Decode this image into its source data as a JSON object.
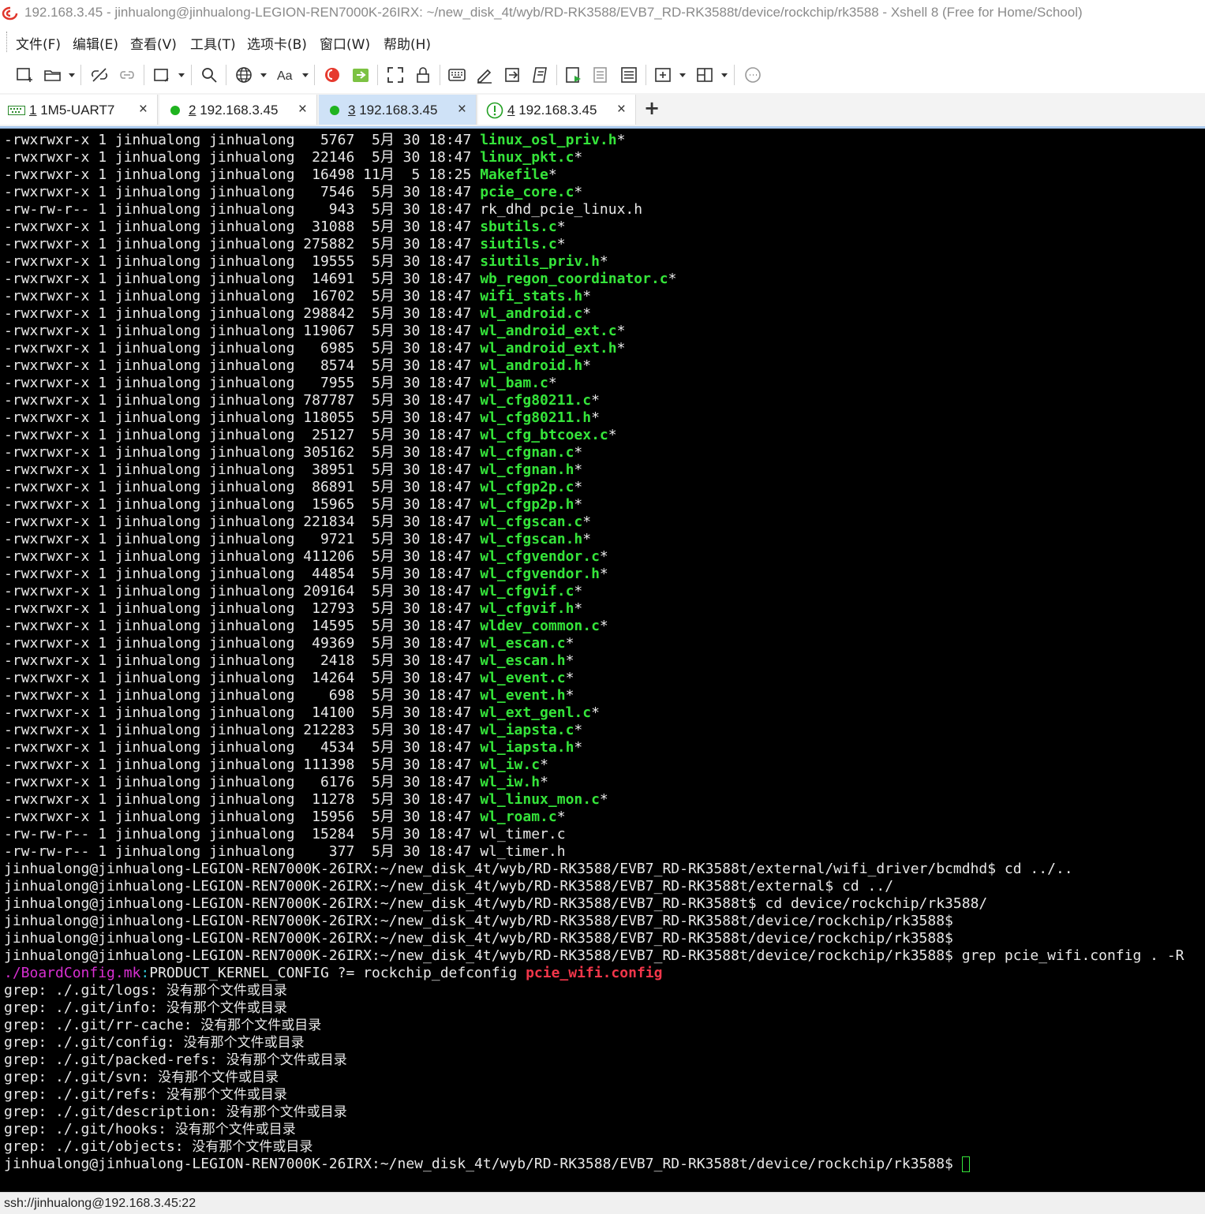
{
  "window": {
    "title": "192.168.3.45 - jinhualong@jinhualong-LEGION-REN7000K-26IRX: ~/new_disk_4t/wyb/RD-RK3588/EVB7_RD-RK3588t/device/rockchip/rk3588 - Xshell 8 (Free for Home/School)"
  },
  "menu": [
    {
      "label": "文件(F)"
    },
    {
      "label": "编辑(E)"
    },
    {
      "label": "查看(V)"
    },
    {
      "label": "工具(T)"
    },
    {
      "label": "选项卡(B)"
    },
    {
      "label": "窗口(W)"
    },
    {
      "label": "帮助(H)"
    }
  ],
  "tabs": [
    {
      "num": "1",
      "name": "1M5-UART7",
      "status": "serial",
      "active": false
    },
    {
      "num": "2",
      "name": "192.168.3.45",
      "status": "connected",
      "active": false
    },
    {
      "num": "3",
      "name": "192.168.3.45",
      "status": "connected",
      "active": true
    },
    {
      "num": "4",
      "name": "192.168.3.45",
      "status": "warning",
      "active": false
    }
  ],
  "terminal": {
    "listing": [
      {
        "meta": "-rwxrwxr-x 1 jinhualong jinhualong   5767  5月 30 18:47 ",
        "name": "linux_osl_priv.h",
        "exec": true
      },
      {
        "meta": "-rwxrwxr-x 1 jinhualong jinhualong  22146  5月 30 18:47 ",
        "name": "linux_pkt.c",
        "exec": true
      },
      {
        "meta": "-rwxrwxr-x 1 jinhualong jinhualong  16498 11月  5 18:25 ",
        "name": "Makefile",
        "exec": true
      },
      {
        "meta": "-rwxrwxr-x 1 jinhualong jinhualong   7546  5月 30 18:47 ",
        "name": "pcie_core.c",
        "exec": true
      },
      {
        "meta": "-rw-rw-r-- 1 jinhualong jinhualong    943  5月 30 18:47 ",
        "name": "rk_dhd_pcie_linux.h",
        "exec": false
      },
      {
        "meta": "-rwxrwxr-x 1 jinhualong jinhualong  31088  5月 30 18:47 ",
        "name": "sbutils.c",
        "exec": true
      },
      {
        "meta": "-rwxrwxr-x 1 jinhualong jinhualong 275882  5月 30 18:47 ",
        "name": "siutils.c",
        "exec": true
      },
      {
        "meta": "-rwxrwxr-x 1 jinhualong jinhualong  19555  5月 30 18:47 ",
        "name": "siutils_priv.h",
        "exec": true
      },
      {
        "meta": "-rwxrwxr-x 1 jinhualong jinhualong  14691  5月 30 18:47 ",
        "name": "wb_regon_coordinator.c",
        "exec": true
      },
      {
        "meta": "-rwxrwxr-x 1 jinhualong jinhualong  16702  5月 30 18:47 ",
        "name": "wifi_stats.h",
        "exec": true
      },
      {
        "meta": "-rwxrwxr-x 1 jinhualong jinhualong 298842  5月 30 18:47 ",
        "name": "wl_android.c",
        "exec": true
      },
      {
        "meta": "-rwxrwxr-x 1 jinhualong jinhualong 119067  5月 30 18:47 ",
        "name": "wl_android_ext.c",
        "exec": true
      },
      {
        "meta": "-rwxrwxr-x 1 jinhualong jinhualong   6985  5月 30 18:47 ",
        "name": "wl_android_ext.h",
        "exec": true
      },
      {
        "meta": "-rwxrwxr-x 1 jinhualong jinhualong   8574  5月 30 18:47 ",
        "name": "wl_android.h",
        "exec": true
      },
      {
        "meta": "-rwxrwxr-x 1 jinhualong jinhualong   7955  5月 30 18:47 ",
        "name": "wl_bam.c",
        "exec": true
      },
      {
        "meta": "-rwxrwxr-x 1 jinhualong jinhualong 787787  5月 30 18:47 ",
        "name": "wl_cfg80211.c",
        "exec": true
      },
      {
        "meta": "-rwxrwxr-x 1 jinhualong jinhualong 118055  5月 30 18:47 ",
        "name": "wl_cfg80211.h",
        "exec": true
      },
      {
        "meta": "-rwxrwxr-x 1 jinhualong jinhualong  25127  5月 30 18:47 ",
        "name": "wl_cfg_btcoex.c",
        "exec": true
      },
      {
        "meta": "-rwxrwxr-x 1 jinhualong jinhualong 305162  5月 30 18:47 ",
        "name": "wl_cfgnan.c",
        "exec": true
      },
      {
        "meta": "-rwxrwxr-x 1 jinhualong jinhualong  38951  5月 30 18:47 ",
        "name": "wl_cfgnan.h",
        "exec": true
      },
      {
        "meta": "-rwxrwxr-x 1 jinhualong jinhualong  86891  5月 30 18:47 ",
        "name": "wl_cfgp2p.c",
        "exec": true
      },
      {
        "meta": "-rwxrwxr-x 1 jinhualong jinhualong  15965  5月 30 18:47 ",
        "name": "wl_cfgp2p.h",
        "exec": true
      },
      {
        "meta": "-rwxrwxr-x 1 jinhualong jinhualong 221834  5月 30 18:47 ",
        "name": "wl_cfgscan.c",
        "exec": true
      },
      {
        "meta": "-rwxrwxr-x 1 jinhualong jinhualong   9721  5月 30 18:47 ",
        "name": "wl_cfgscan.h",
        "exec": true
      },
      {
        "meta": "-rwxrwxr-x 1 jinhualong jinhualong 411206  5月 30 18:47 ",
        "name": "wl_cfgvendor.c",
        "exec": true
      },
      {
        "meta": "-rwxrwxr-x 1 jinhualong jinhualong  44854  5月 30 18:47 ",
        "name": "wl_cfgvendor.h",
        "exec": true
      },
      {
        "meta": "-rwxrwxr-x 1 jinhualong jinhualong 209164  5月 30 18:47 ",
        "name": "wl_cfgvif.c",
        "exec": true
      },
      {
        "meta": "-rwxrwxr-x 1 jinhualong jinhualong  12793  5月 30 18:47 ",
        "name": "wl_cfgvif.h",
        "exec": true
      },
      {
        "meta": "-rwxrwxr-x 1 jinhualong jinhualong  14595  5月 30 18:47 ",
        "name": "wldev_common.c",
        "exec": true
      },
      {
        "meta": "-rwxrwxr-x 1 jinhualong jinhualong  49369  5月 30 18:47 ",
        "name": "wl_escan.c",
        "exec": true
      },
      {
        "meta": "-rwxrwxr-x 1 jinhualong jinhualong   2418  5月 30 18:47 ",
        "name": "wl_escan.h",
        "exec": true
      },
      {
        "meta": "-rwxrwxr-x 1 jinhualong jinhualong  14264  5月 30 18:47 ",
        "name": "wl_event.c",
        "exec": true
      },
      {
        "meta": "-rwxrwxr-x 1 jinhualong jinhualong    698  5月 30 18:47 ",
        "name": "wl_event.h",
        "exec": true
      },
      {
        "meta": "-rwxrwxr-x 1 jinhualong jinhualong  14100  5月 30 18:47 ",
        "name": "wl_ext_genl.c",
        "exec": true
      },
      {
        "meta": "-rwxrwxr-x 1 jinhualong jinhualong 212283  5月 30 18:47 ",
        "name": "wl_iapsta.c",
        "exec": true
      },
      {
        "meta": "-rwxrwxr-x 1 jinhualong jinhualong   4534  5月 30 18:47 ",
        "name": "wl_iapsta.h",
        "exec": true
      },
      {
        "meta": "-rwxrwxr-x 1 jinhualong jinhualong 111398  5月 30 18:47 ",
        "name": "wl_iw.c",
        "exec": true
      },
      {
        "meta": "-rwxrwxr-x 1 jinhualong jinhualong   6176  5月 30 18:47 ",
        "name": "wl_iw.h",
        "exec": true
      },
      {
        "meta": "-rwxrwxr-x 1 jinhualong jinhualong  11278  5月 30 18:47 ",
        "name": "wl_linux_mon.c",
        "exec": true
      },
      {
        "meta": "-rwxrwxr-x 1 jinhualong jinhualong  15956  5月 30 18:47 ",
        "name": "wl_roam.c",
        "exec": true
      },
      {
        "meta": "-rw-rw-r-- 1 jinhualong jinhualong  15284  5月 30 18:47 ",
        "name": "wl_timer.c",
        "exec": false
      },
      {
        "meta": "-rw-rw-r-- 1 jinhualong jinhualong    377  5月 30 18:47 ",
        "name": "wl_timer.h",
        "exec": false
      }
    ],
    "commands": [
      "jinhualong@jinhualong-LEGION-REN7000K-26IRX:~/new_disk_4t/wyb/RD-RK3588/EVB7_RD-RK3588t/external/wifi_driver/bcmdhd$ cd ../..",
      "jinhualong@jinhualong-LEGION-REN7000K-26IRX:~/new_disk_4t/wyb/RD-RK3588/EVB7_RD-RK3588t/external$ cd ../",
      "jinhualong@jinhualong-LEGION-REN7000K-26IRX:~/new_disk_4t/wyb/RD-RK3588/EVB7_RD-RK3588t$ cd device/rockchip/rk3588/",
      "jinhualong@jinhualong-LEGION-REN7000K-26IRX:~/new_disk_4t/wyb/RD-RK3588/EVB7_RD-RK3588t/device/rockchip/rk3588$",
      "jinhualong@jinhualong-LEGION-REN7000K-26IRX:~/new_disk_4t/wyb/RD-RK3588/EVB7_RD-RK3588t/device/rockchip/rk3588$",
      "jinhualong@jinhualong-LEGION-REN7000K-26IRX:~/new_disk_4t/wyb/RD-RK3588/EVB7_RD-RK3588t/device/rockchip/rk3588$ grep pcie_wifi.config . -R"
    ],
    "grep_match": {
      "file": "./BoardConfig.mk",
      "sep": ":",
      "text": "PRODUCT_KERNEL_CONFIG ?= rockchip_defconfig ",
      "match": "pcie_wifi.config"
    },
    "grep_errors": [
      {
        "prefix": "grep: ./.git/logs: ",
        "msg": "没有那个文件或目录"
      },
      {
        "prefix": "grep: ./.git/info: ",
        "msg": "没有那个文件或目录"
      },
      {
        "prefix": "grep: ./.git/rr-cache: ",
        "msg": "没有那个文件或目录"
      },
      {
        "prefix": "grep: ./.git/config: ",
        "msg": "没有那个文件或目录"
      },
      {
        "prefix": "grep: ./.git/packed-refs: ",
        "msg": "没有那个文件或目录"
      },
      {
        "prefix": "grep: ./.git/svn: ",
        "msg": "没有那个文件或目录"
      },
      {
        "prefix": "grep: ./.git/refs: ",
        "msg": "没有那个文件或目录"
      },
      {
        "prefix": "grep: ./.git/description: ",
        "msg": "没有那个文件或目录"
      },
      {
        "prefix": "grep: ./.git/hooks: ",
        "msg": "没有那个文件或目录"
      },
      {
        "prefix": "grep: ./.git/objects: ",
        "msg": "没有那个文件或目录"
      }
    ],
    "prompt": "jinhualong@jinhualong-LEGION-REN7000K-26IRX:~/new_disk_4t/wyb/RD-RK3588/EVB7_RD-RK3588t/device/rockchip/rk3588$ "
  },
  "statusbar": {
    "text": "ssh://jinhualong@192.168.3.45:22"
  },
  "colors": {
    "terminal_bg": "#000000",
    "terminal_fg": "#e8e8e8",
    "exec_green": "#35e43a",
    "path_magenta": "#d82fd2",
    "match_red": "#f2364a",
    "active_tab": "#cfe2f7"
  },
  "icons": {
    "toolbar": [
      "new-session-icon",
      "open-session-icon",
      "disconnect-icon",
      "reconnect-icon",
      "new-window-icon",
      "find-icon",
      "globe-icon",
      "font-icon",
      "xshell-logo-icon",
      "xftp-icon",
      "fullscreen-icon",
      "lock-icon",
      "keyboard-icon",
      "highlight-icon",
      "transfer-icon",
      "script-icon",
      "compose-icon",
      "compose-bar-icon",
      "notes-icon",
      "add-pane-icon",
      "layout-icon",
      "chat-icon"
    ]
  }
}
